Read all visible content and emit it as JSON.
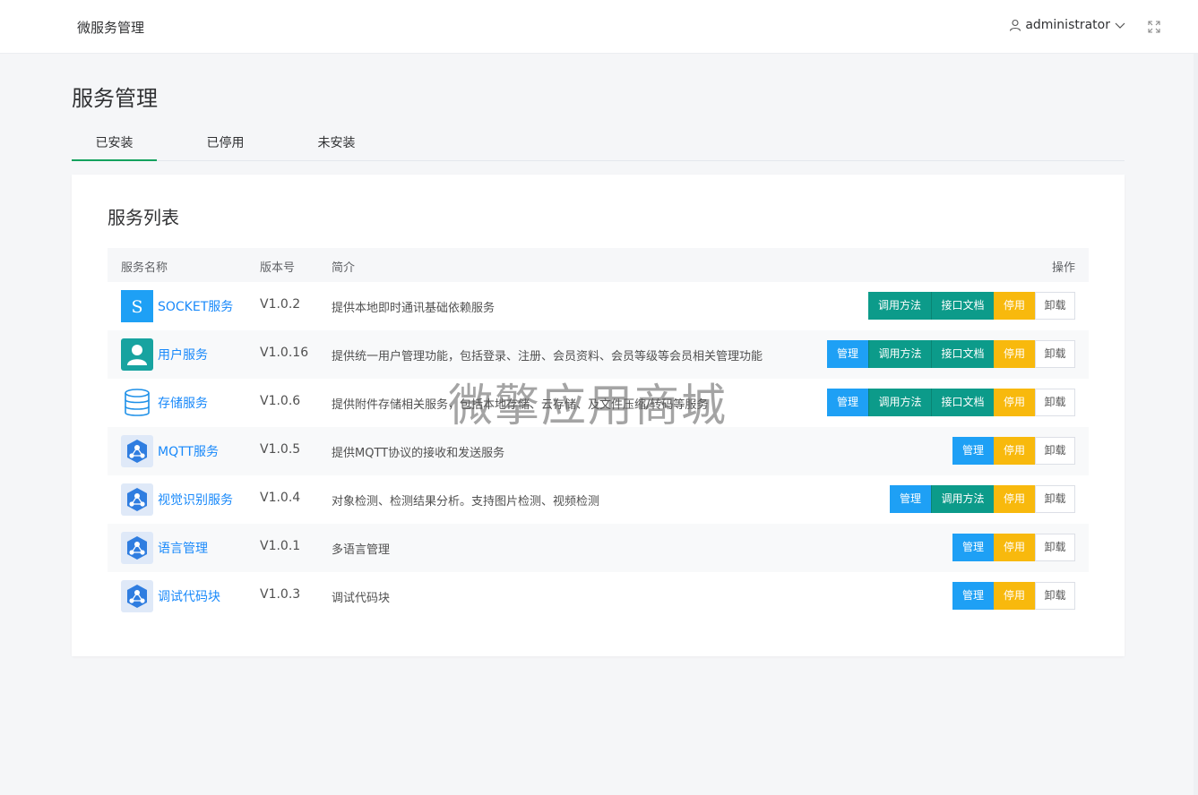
{
  "header": {
    "app_title": "微服务管理",
    "username": "administrator",
    "user_icon": "user-icon",
    "fullscreen_icon": "fullscreen-icon"
  },
  "page": {
    "title": "服务管理",
    "tabs": [
      "已安装",
      "已停用",
      "未安装"
    ],
    "active_tab": "已安装"
  },
  "card": {
    "title": "服务列表",
    "columns": [
      "服务名称",
      "版本号",
      "简介",
      "操作"
    ],
    "rows": [
      {
        "icon": "socket-s-icon",
        "name": "SOCKET服务",
        "version": "V1.0.2",
        "desc": "提供本地即时通讯基础依赖服务",
        "actions": [
          "调用方法",
          "接口文档",
          "停用",
          "卸载"
        ]
      },
      {
        "icon": "user-service-icon",
        "name": "用户服务",
        "version": "V1.0.16",
        "desc": "提供统一用户管理功能，包括登录、注册、会员资料、会员等级等会员相关管理功能",
        "actions": [
          "管理",
          "调用方法",
          "接口文档",
          "停用",
          "卸载"
        ]
      },
      {
        "icon": "database-icon",
        "name": "存储服务",
        "version": "V1.0.6",
        "desc": "提供附件存储相关服务，包括本地存储、云存储、及文件压缩/转码等服务",
        "actions": [
          "管理",
          "调用方法",
          "接口文档",
          "停用",
          "卸载"
        ]
      },
      {
        "icon": "network-hub-icon",
        "name": "MQTT服务",
        "version": "V1.0.5",
        "desc": "提供MQTT协议的接收和发送服务",
        "actions": [
          "管理",
          "停用",
          "卸载"
        ]
      },
      {
        "icon": "network-hub-icon",
        "name": "视觉识别服务",
        "version": "V1.0.4",
        "desc": "对象检测、检测结果分析。支持图片检测、视频检测",
        "actions": [
          "管理",
          "调用方法",
          "停用",
          "卸载"
        ]
      },
      {
        "icon": "network-hub-icon",
        "name": "语言管理",
        "version": "V1.0.1",
        "desc": "多语言管理",
        "actions": [
          "管理",
          "停用",
          "卸载"
        ]
      },
      {
        "icon": "network-hub-icon",
        "name": "调试代码块",
        "version": "V1.0.3",
        "desc": "调试代码块",
        "actions": [
          "管理",
          "停用",
          "卸载"
        ]
      }
    ]
  },
  "watermark": "微擎应用商城",
  "colors": {
    "primary_blue": "#1ea0f5",
    "teal": "#0c9b8a",
    "yellow": "#f8b90d",
    "tab_active": "#14a25e",
    "link": "#1989fa"
  }
}
